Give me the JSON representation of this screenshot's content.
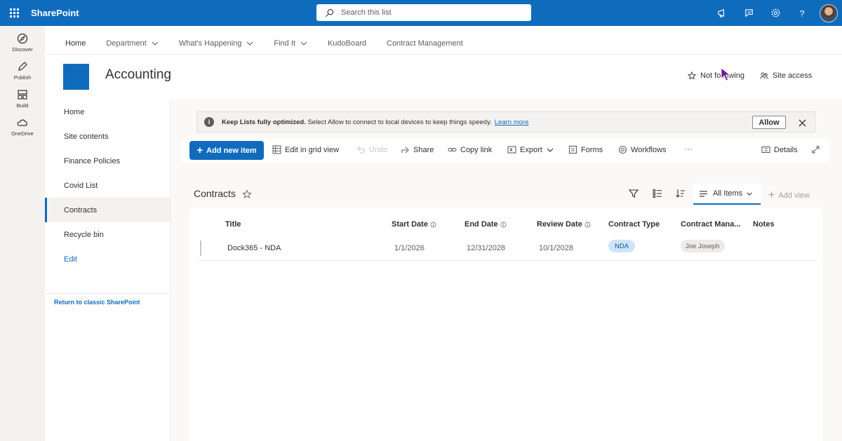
{
  "suitebar": {
    "brand": "SharePoint",
    "search_placeholder": "Search this list"
  },
  "appbar": {
    "items": [
      {
        "label": "Discover",
        "icon": "compass-icon"
      },
      {
        "label": "Publish",
        "icon": "pen-icon"
      },
      {
        "label": "Build",
        "icon": "layout-icon"
      },
      {
        "label": "OneDrive",
        "icon": "cloud-icon"
      }
    ]
  },
  "hubnav": {
    "items": [
      {
        "label": "Home",
        "dropdown": false
      },
      {
        "label": "Department",
        "dropdown": true
      },
      {
        "label": "What's Happening",
        "dropdown": true
      },
      {
        "label": "Find It",
        "dropdown": true
      },
      {
        "label": "KudoBoard",
        "dropdown": false
      },
      {
        "label": "Contract Management",
        "dropdown": false
      }
    ]
  },
  "site": {
    "title": "Accounting",
    "logo_color": "#0f6cbd",
    "follow_label": "Not following",
    "access_label": "Site access"
  },
  "leftnav": {
    "items": [
      {
        "label": "Home"
      },
      {
        "label": "Site contents"
      },
      {
        "label": "Finance Policies"
      },
      {
        "label": "Covid List"
      },
      {
        "label": "Contracts",
        "selected": true
      },
      {
        "label": "Recycle bin"
      },
      {
        "label": "Edit"
      }
    ],
    "classic_link": "Return to classic SharePoint"
  },
  "banner": {
    "bold": "Keep Lists fully optimized.",
    "text": "Select Allow to connect to local devices to keep things speedy.",
    "link": "Learn more",
    "allow_label": "Allow"
  },
  "commandbar": {
    "add_label": "Add new item",
    "edit_grid": "Edit in grid view",
    "undo": "Undo",
    "share": "Share",
    "copy_link": "Copy link",
    "export": "Export",
    "forms": "Forms",
    "workflows": "Workflows",
    "more": "···",
    "details": "Details"
  },
  "list": {
    "title": "Contracts",
    "view_label": "All Items",
    "add_view": "Add view",
    "columns": [
      "Title",
      "Start Date",
      "End Date",
      "Review Date",
      "Contract Type",
      "Contract Mana...",
      "Notes"
    ],
    "rows": [
      {
        "title": "Dock365 - NDA",
        "start": "1/1/2026",
        "end": "12/31/2028",
        "review": "10/1/2028",
        "type": "NDA",
        "manager": "Joe Joseph"
      }
    ]
  },
  "colors": {
    "accent": "#0f6cbd"
  }
}
